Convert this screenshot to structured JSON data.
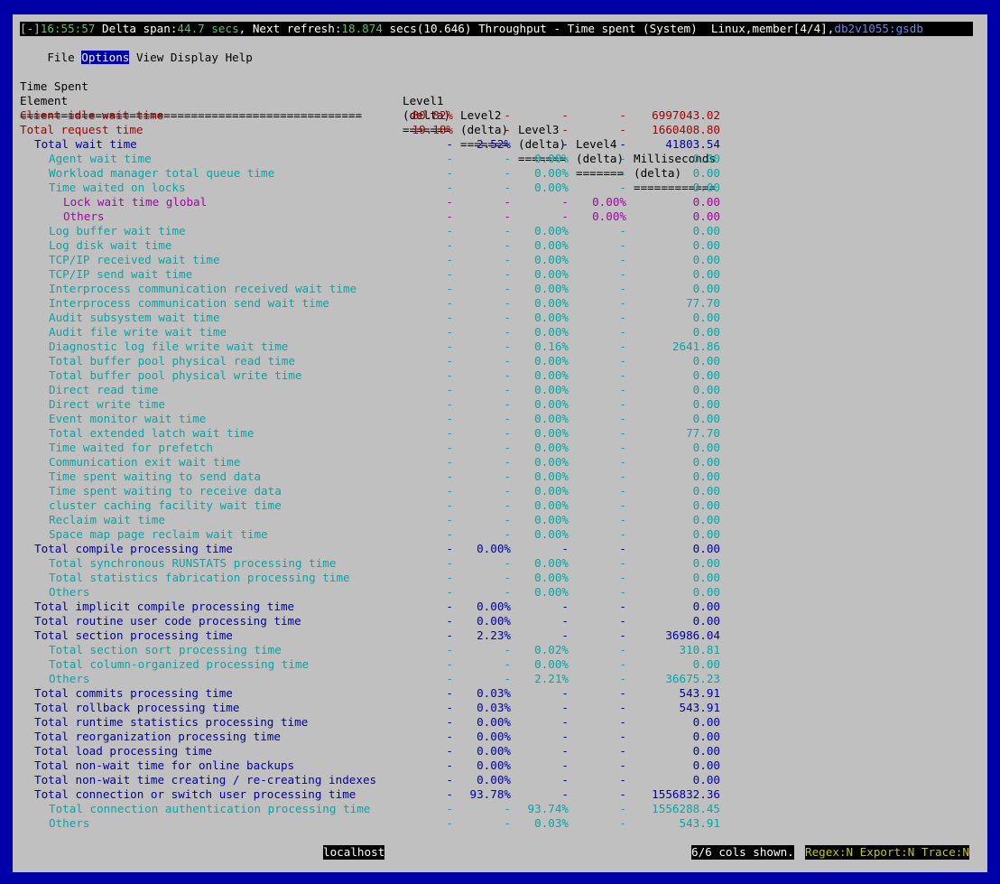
{
  "title_bar": {
    "bracket": "[-]",
    "time": "16:55:57",
    "delta_label": " Delta span:",
    "delta_value": "44.7 secs",
    "refresh_label": ", Next refresh:",
    "refresh_value": "18.874",
    "refresh_suffix": " secs(10.646) ",
    "view_title": "Throughput - Time spent (System)",
    "platform": "  Linux,member[4/4],",
    "database": "db2v1055:gsdb"
  },
  "menu": [
    "File",
    "Options",
    "View",
    "Display",
    "Help"
  ],
  "menu_active": "Options",
  "headers": {
    "line1": [
      "Time Spent",
      "Level1",
      "Level2",
      "Level3",
      "Level4",
      "Milliseconds"
    ],
    "line2": [
      "Element",
      "(delta)",
      "(delta)",
      "(delta)",
      "(delta)",
      "(delta)"
    ],
    "rule_name": "==================================================",
    "rule_col": "=======",
    "rule_ms": "============"
  },
  "rows": [
    {
      "name": "Client idle wait time",
      "indent": 0,
      "color": "red",
      "l1": "80.82%",
      "l2": "-",
      "l3": "-",
      "l4": "-",
      "ms": "6997043.02"
    },
    {
      "name": "Total request time",
      "indent": 0,
      "color": "red",
      "l1": "19.18%",
      "l2": "-",
      "l3": "-",
      "l4": "-",
      "ms": "1660408.80"
    },
    {
      "name": "Total wait time",
      "indent": 1,
      "color": "blue",
      "l1": "-",
      "l2": "2.52%",
      "l3": "-",
      "l4": "-",
      "ms": "41803.54"
    },
    {
      "name": "Agent wait time",
      "indent": 2,
      "color": "cyan",
      "l1": "-",
      "l2": "-",
      "l3": "0.00%",
      "l4": "-",
      "ms": "0.00"
    },
    {
      "name": "Workload manager total queue time",
      "indent": 2,
      "color": "cyan",
      "l1": "-",
      "l2": "-",
      "l3": "0.00%",
      "l4": "-",
      "ms": "0.00"
    },
    {
      "name": "Time waited on locks",
      "indent": 2,
      "color": "cyan",
      "l1": "-",
      "l2": "-",
      "l3": "0.00%",
      "l4": "-",
      "ms": "0.00"
    },
    {
      "name": "Lock wait time global",
      "indent": 3,
      "color": "mag",
      "l1": "-",
      "l2": "-",
      "l3": "-",
      "l4": "0.00%",
      "ms": "0.00"
    },
    {
      "name": "Others",
      "indent": 3,
      "color": "mag",
      "l1": "-",
      "l2": "-",
      "l3": "-",
      "l4": "0.00%",
      "ms": "0.00"
    },
    {
      "name": "Log buffer wait time",
      "indent": 2,
      "color": "cyan",
      "l1": "-",
      "l2": "-",
      "l3": "0.00%",
      "l4": "-",
      "ms": "0.00"
    },
    {
      "name": "Log disk wait time",
      "indent": 2,
      "color": "cyan",
      "l1": "-",
      "l2": "-",
      "l3": "0.00%",
      "l4": "-",
      "ms": "0.00"
    },
    {
      "name": "TCP/IP received wait time",
      "indent": 2,
      "color": "cyan",
      "l1": "-",
      "l2": "-",
      "l3": "0.00%",
      "l4": "-",
      "ms": "0.00"
    },
    {
      "name": "TCP/IP send wait time",
      "indent": 2,
      "color": "cyan",
      "l1": "-",
      "l2": "-",
      "l3": "0.00%",
      "l4": "-",
      "ms": "0.00"
    },
    {
      "name": "Interprocess communication received wait time",
      "indent": 2,
      "color": "cyan",
      "l1": "-",
      "l2": "-",
      "l3": "0.00%",
      "l4": "-",
      "ms": "0.00"
    },
    {
      "name": "Interprocess communication send wait time",
      "indent": 2,
      "color": "cyan",
      "l1": "-",
      "l2": "-",
      "l3": "0.00%",
      "l4": "-",
      "ms": "77.70"
    },
    {
      "name": "Audit subsystem wait time",
      "indent": 2,
      "color": "cyan",
      "l1": "-",
      "l2": "-",
      "l3": "0.00%",
      "l4": "-",
      "ms": "0.00"
    },
    {
      "name": "Audit file write wait time",
      "indent": 2,
      "color": "cyan",
      "l1": "-",
      "l2": "-",
      "l3": "0.00%",
      "l4": "-",
      "ms": "0.00"
    },
    {
      "name": "Diagnostic log file write wait time",
      "indent": 2,
      "color": "cyan",
      "l1": "-",
      "l2": "-",
      "l3": "0.16%",
      "l4": "-",
      "ms": "2641.86"
    },
    {
      "name": "Total buffer pool physical read time",
      "indent": 2,
      "color": "cyan",
      "l1": "-",
      "l2": "-",
      "l3": "0.00%",
      "l4": "-",
      "ms": "0.00"
    },
    {
      "name": "Total buffer pool physical write time",
      "indent": 2,
      "color": "cyan",
      "l1": "-",
      "l2": "-",
      "l3": "0.00%",
      "l4": "-",
      "ms": "0.00"
    },
    {
      "name": "Direct read time",
      "indent": 2,
      "color": "cyan",
      "l1": "-",
      "l2": "-",
      "l3": "0.00%",
      "l4": "-",
      "ms": "0.00"
    },
    {
      "name": "Direct write time",
      "indent": 2,
      "color": "cyan",
      "l1": "-",
      "l2": "-",
      "l3": "0.00%",
      "l4": "-",
      "ms": "0.00"
    },
    {
      "name": "Event monitor wait time",
      "indent": 2,
      "color": "cyan",
      "l1": "-",
      "l2": "-",
      "l3": "0.00%",
      "l4": "-",
      "ms": "0.00"
    },
    {
      "name": "Total extended latch wait time",
      "indent": 2,
      "color": "cyan",
      "l1": "-",
      "l2": "-",
      "l3": "0.00%",
      "l4": "-",
      "ms": "77.70"
    },
    {
      "name": "Time waited for prefetch",
      "indent": 2,
      "color": "cyan",
      "l1": "-",
      "l2": "-",
      "l3": "0.00%",
      "l4": "-",
      "ms": "0.00"
    },
    {
      "name": "Communication exit wait time",
      "indent": 2,
      "color": "cyan",
      "l1": "-",
      "l2": "-",
      "l3": "0.00%",
      "l4": "-",
      "ms": "0.00"
    },
    {
      "name": "Time spent waiting to send data",
      "indent": 2,
      "color": "cyan",
      "l1": "-",
      "l2": "-",
      "l3": "0.00%",
      "l4": "-",
      "ms": "0.00"
    },
    {
      "name": "Time spent waiting to receive data",
      "indent": 2,
      "color": "cyan",
      "l1": "-",
      "l2": "-",
      "l3": "0.00%",
      "l4": "-",
      "ms": "0.00"
    },
    {
      "name": "cluster caching facility wait time",
      "indent": 2,
      "color": "cyan",
      "l1": "-",
      "l2": "-",
      "l3": "0.00%",
      "l4": "-",
      "ms": "0.00"
    },
    {
      "name": "Reclaim wait time",
      "indent": 2,
      "color": "cyan",
      "l1": "-",
      "l2": "-",
      "l3": "0.00%",
      "l4": "-",
      "ms": "0.00"
    },
    {
      "name": "Space map page reclaim wait time",
      "indent": 2,
      "color": "cyan",
      "l1": "-",
      "l2": "-",
      "l3": "0.00%",
      "l4": "-",
      "ms": "0.00"
    },
    {
      "name": "Total compile processing time",
      "indent": 1,
      "color": "blue",
      "l1": "-",
      "l2": "0.00%",
      "l3": "-",
      "l4": "-",
      "ms": "0.00"
    },
    {
      "name": "Total synchronous RUNSTATS processing time",
      "indent": 2,
      "color": "cyan",
      "l1": "-",
      "l2": "-",
      "l3": "0.00%",
      "l4": "-",
      "ms": "0.00"
    },
    {
      "name": "Total statistics fabrication processing time",
      "indent": 2,
      "color": "cyan",
      "l1": "-",
      "l2": "-",
      "l3": "0.00%",
      "l4": "-",
      "ms": "0.00"
    },
    {
      "name": "Others",
      "indent": 2,
      "color": "cyan",
      "l1": "-",
      "l2": "-",
      "l3": "0.00%",
      "l4": "-",
      "ms": "0.00"
    },
    {
      "name": "Total implicit compile processing time",
      "indent": 1,
      "color": "blue",
      "l1": "-",
      "l2": "0.00%",
      "l3": "-",
      "l4": "-",
      "ms": "0.00"
    },
    {
      "name": "Total routine user code processing time",
      "indent": 1,
      "color": "blue",
      "l1": "-",
      "l2": "0.00%",
      "l3": "-",
      "l4": "-",
      "ms": "0.00"
    },
    {
      "name": "Total section processing time",
      "indent": 1,
      "color": "blue",
      "l1": "-",
      "l2": "2.23%",
      "l3": "-",
      "l4": "-",
      "ms": "36986.04"
    },
    {
      "name": "Total section sort processing time",
      "indent": 2,
      "color": "cyan",
      "l1": "-",
      "l2": "-",
      "l3": "0.02%",
      "l4": "-",
      "ms": "310.81"
    },
    {
      "name": "Total column-organized processing time",
      "indent": 2,
      "color": "cyan",
      "l1": "-",
      "l2": "-",
      "l3": "0.00%",
      "l4": "-",
      "ms": "0.00"
    },
    {
      "name": "Others",
      "indent": 2,
      "color": "cyan",
      "l1": "-",
      "l2": "-",
      "l3": "2.21%",
      "l4": "-",
      "ms": "36675.23"
    },
    {
      "name": "Total commits processing time",
      "indent": 1,
      "color": "blue",
      "l1": "-",
      "l2": "0.03%",
      "l3": "-",
      "l4": "-",
      "ms": "543.91"
    },
    {
      "name": "Total rollback processing time",
      "indent": 1,
      "color": "blue",
      "l1": "-",
      "l2": "0.03%",
      "l3": "-",
      "l4": "-",
      "ms": "543.91"
    },
    {
      "name": "Total runtime statistics processing time",
      "indent": 1,
      "color": "blue",
      "l1": "-",
      "l2": "0.00%",
      "l3": "-",
      "l4": "-",
      "ms": "0.00"
    },
    {
      "name": "Total reorganization processing time",
      "indent": 1,
      "color": "blue",
      "l1": "-",
      "l2": "0.00%",
      "l3": "-",
      "l4": "-",
      "ms": "0.00"
    },
    {
      "name": "Total load processing time",
      "indent": 1,
      "color": "blue",
      "l1": "-",
      "l2": "0.00%",
      "l3": "-",
      "l4": "-",
      "ms": "0.00"
    },
    {
      "name": "Total non-wait time for online backups",
      "indent": 1,
      "color": "blue",
      "l1": "-",
      "l2": "0.00%",
      "l3": "-",
      "l4": "-",
      "ms": "0.00"
    },
    {
      "name": "Total non-wait time creating / re-creating indexes",
      "indent": 1,
      "color": "blue",
      "l1": "-",
      "l2": "0.00%",
      "l3": "-",
      "l4": "-",
      "ms": "0.00"
    },
    {
      "name": "Total connection or switch user processing time",
      "indent": 1,
      "color": "blue",
      "l1": "-",
      "l2": "93.78%",
      "l3": "-",
      "l4": "-",
      "ms": "1556832.36"
    },
    {
      "name": "Total connection authentication processing time",
      "indent": 2,
      "color": "cyan",
      "l1": "-",
      "l2": "-",
      "l3": "93.74%",
      "l4": "-",
      "ms": "1556288.45"
    },
    {
      "name": "Others",
      "indent": 2,
      "color": "cyan",
      "l1": "-",
      "l2": "-",
      "l3": "0.03%",
      "l4": "-",
      "ms": "543.91"
    }
  ],
  "status_bar": {
    "host": "localhost",
    "cols": "6/6 cols shown.",
    "flags": "Regex:N Export:N Trace:N"
  }
}
